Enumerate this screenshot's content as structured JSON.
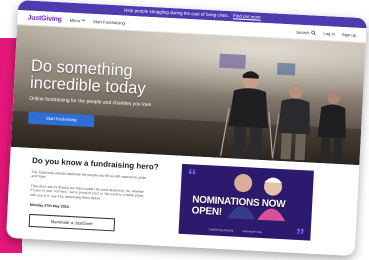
{
  "banner": {
    "text": "Help people struggling during the cost of living crisis.",
    "link": "Find out more"
  },
  "nav": {
    "logo": "JustGiving",
    "menu": "Menu",
    "fundraise": "Start Fundraising",
    "search": "Search",
    "login": "Log in",
    "signup": "Sign up"
  },
  "hero": {
    "headline_line1": "Do something",
    "headline_line2": "incredible today",
    "subtitle": "Online fundraising for the people and charities you love",
    "cta": "Start fundraising"
  },
  "section": {
    "title": "Do you know a fundraising hero?",
    "p1": "The JustGiving awards celebrate the people who fill us with inspiration, pride and hope.",
    "p2": "They don't ask for thanks, but they couldn't be more deserving. So, whether it's you or your 'not-hero', 'we're proud of you!' or 'the world is a better place with you in it', say it by nominating them before",
    "deadline": "Monday 27th May 2023.",
    "button": "Nominate a JustGiver"
  },
  "promo": {
    "headline": "NOMINATIONS NOW OPEN!",
    "small_left": "JustGiving Awards",
    "small_right": "Nominate now"
  },
  "colors": {
    "brand": "#6a2bd9",
    "banner": "#4e3bb0",
    "cta": "#2d6fd6",
    "accent_pink": "#e6177a"
  }
}
